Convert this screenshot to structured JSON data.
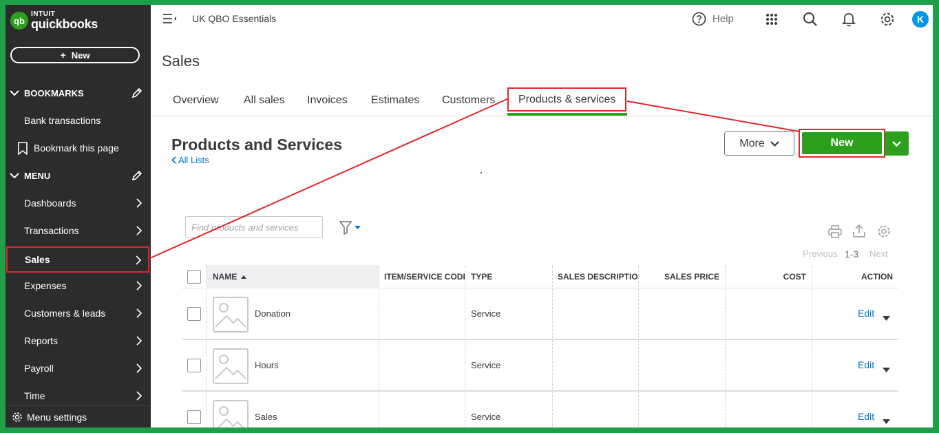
{
  "brand": {
    "logo_mark": "qb",
    "intuit": "INTUIT",
    "product": "quickbooks"
  },
  "sidebar": {
    "new_label": "New",
    "bookmarks_header": "BOOKMARKS",
    "bookmark_items": [
      {
        "label": "Bank transactions"
      },
      {
        "label": "Bookmark this page"
      }
    ],
    "menu_header": "MENU",
    "menu_items": [
      {
        "label": "Dashboards"
      },
      {
        "label": "Transactions"
      },
      {
        "label": "Sales",
        "active": true
      },
      {
        "label": "Expenses"
      },
      {
        "label": "Customers & leads"
      },
      {
        "label": "Reports"
      },
      {
        "label": "Payroll"
      },
      {
        "label": "Time"
      }
    ],
    "menu_settings": "Menu settings"
  },
  "topbar": {
    "company_name": "UK QBO Essentials",
    "help_label": "Help",
    "avatar_initial": "K",
    "icons": [
      "apps-grid-icon",
      "search-icon",
      "bell-icon",
      "gear-icon"
    ]
  },
  "page": {
    "title": "Sales",
    "tabs": [
      {
        "label": "Overview"
      },
      {
        "label": "All sales"
      },
      {
        "label": "Invoices"
      },
      {
        "label": "Estimates"
      },
      {
        "label": "Customers"
      },
      {
        "label": "Products & services",
        "active": true
      }
    ]
  },
  "content": {
    "title": "Products and Services",
    "all_lists_label": "All Lists",
    "more_label": "More",
    "new_label": "New",
    "search_placeholder": "Find products and services",
    "pager": {
      "previous": "Previous",
      "range": "1-3",
      "next": "Next"
    }
  },
  "table": {
    "columns": [
      "NAME",
      "ITEM/SERVICE CODE",
      "TYPE",
      "SALES DESCRIPTION",
      "SALES PRICE",
      "COST",
      "ACTION"
    ],
    "sorted_column": "NAME",
    "rows": [
      {
        "name": "Donation",
        "code": "",
        "type": "Service",
        "description": "",
        "price": "",
        "cost": "",
        "action": "Edit"
      },
      {
        "name": "Hours",
        "code": "",
        "type": "Service",
        "description": "",
        "price": "",
        "cost": "",
        "action": "Edit"
      },
      {
        "name": "Sales",
        "code": "",
        "type": "Service",
        "description": "",
        "price": "",
        "cost": "",
        "action": "Edit"
      }
    ]
  },
  "colors": {
    "brand_green": "#2ca01c",
    "sidebar_bg": "#2c2c2c",
    "link_blue": "#0077c5",
    "annotation_red": "#e0262b",
    "frame_green": "#1fa048"
  }
}
